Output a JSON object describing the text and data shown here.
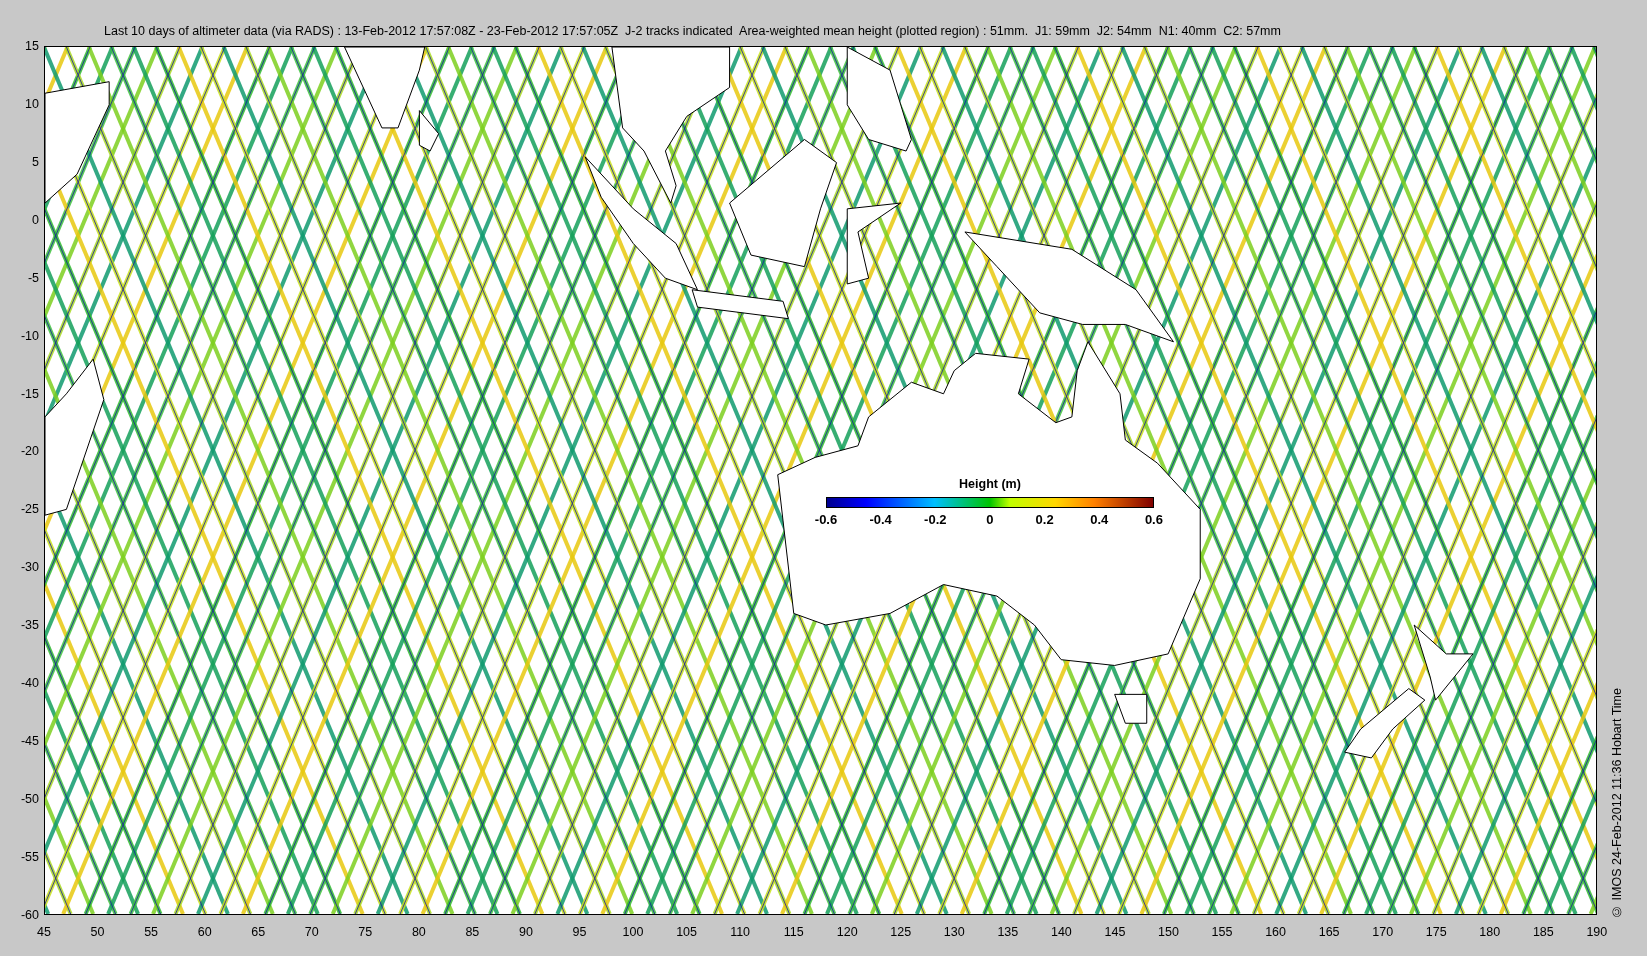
{
  "title": "Last 10 days of altimeter data (via RADS) : 13-Feb-2012 17:57:08Z - 23-Feb-2012 17:57:05Z  J-2 tracks indicated  Area-weighted mean height (plotted region) : 51mm.  J1: 59mm  J2: 54mm  N1: 40mm  C2: 57mm",
  "map": {
    "yticks": [
      "15",
      "10",
      "5",
      "0",
      "-5",
      "-10",
      "-15",
      "-20",
      "-25",
      "-30",
      "-35",
      "-40",
      "-45",
      "-50",
      "-55",
      "-60"
    ],
    "xticks": [
      "45",
      "50",
      "55",
      "60",
      "65",
      "70",
      "75",
      "80",
      "85",
      "90",
      "95",
      "100",
      "105",
      "110",
      "115",
      "120",
      "125",
      "130",
      "135",
      "140",
      "145",
      "150",
      "155",
      "160",
      "165",
      "170",
      "175",
      "180",
      "185",
      "190"
    ]
  },
  "colorbar": {
    "title": "Height (m)",
    "ticks": [
      "-0.6",
      "-0.4",
      "-0.2",
      "0",
      "0.2",
      "0.4",
      "0.6"
    ]
  },
  "credit": "© IMOS 24-Feb-2012 11:36 Hobart Time"
}
